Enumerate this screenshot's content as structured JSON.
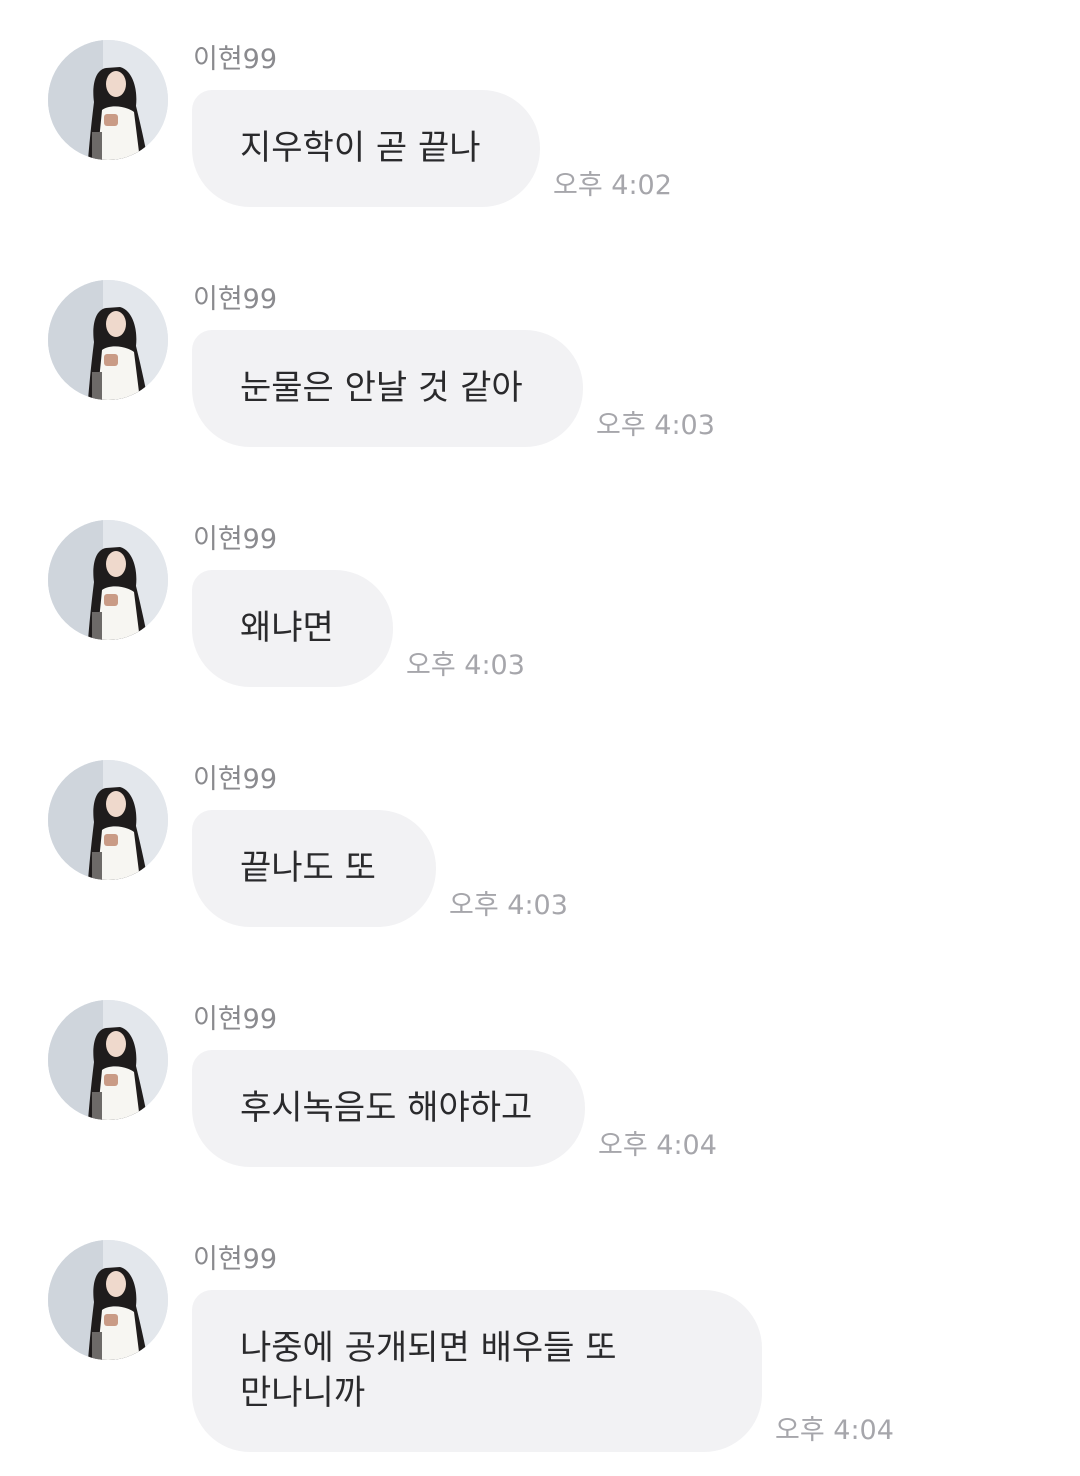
{
  "chat": {
    "messages": [
      {
        "sender": "이현99",
        "text": "지우학이 곧 끝나",
        "time": "오후 4:02"
      },
      {
        "sender": "이현99",
        "text": "눈물은 안날 것 같아",
        "time": "오후 4:03"
      },
      {
        "sender": "이현99",
        "text": "왜냐면",
        "time": "오후 4:03"
      },
      {
        "sender": "이현99",
        "text": "끝나도 또",
        "time": "오후 4:03"
      },
      {
        "sender": "이현99",
        "text": "후시녹음도 해야하고",
        "time": "오후 4:04"
      },
      {
        "sender": "이현99",
        "text": "나중에 공개되면 배우들 또\n만나니까",
        "time": "오후 4:04"
      }
    ]
  },
  "colors": {
    "bubble_background": "#f2f2f4",
    "message_text": "#2a2a2c",
    "sender_text": "#8a8a8e",
    "time_text": "#a6a6ab"
  },
  "icons": {
    "avatar": "profile-photo"
  }
}
